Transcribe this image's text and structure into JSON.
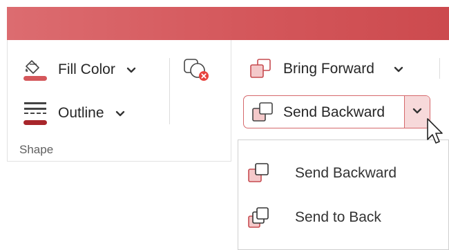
{
  "colors": {
    "accent": "#d4575b",
    "accent_light": "#f7d9da",
    "titlebar": "#d4575b"
  },
  "shape_group": {
    "fill_color_label": "Fill Color",
    "outline_label": "Outline",
    "group_label": "Shape",
    "icons": {
      "fill": "paint-bucket-icon",
      "outline": "outline-lines-icon",
      "shape": "shape-remove-icon"
    }
  },
  "arrange_group": {
    "bring_forward_label": "Bring Forward",
    "send_backward_label": "Send Backward"
  },
  "send_backward_menu": {
    "items": [
      {
        "label": "Send Backward",
        "icon": "send-backward-icon"
      },
      {
        "label": "Send to Back",
        "icon": "send-to-back-icon"
      }
    ]
  }
}
